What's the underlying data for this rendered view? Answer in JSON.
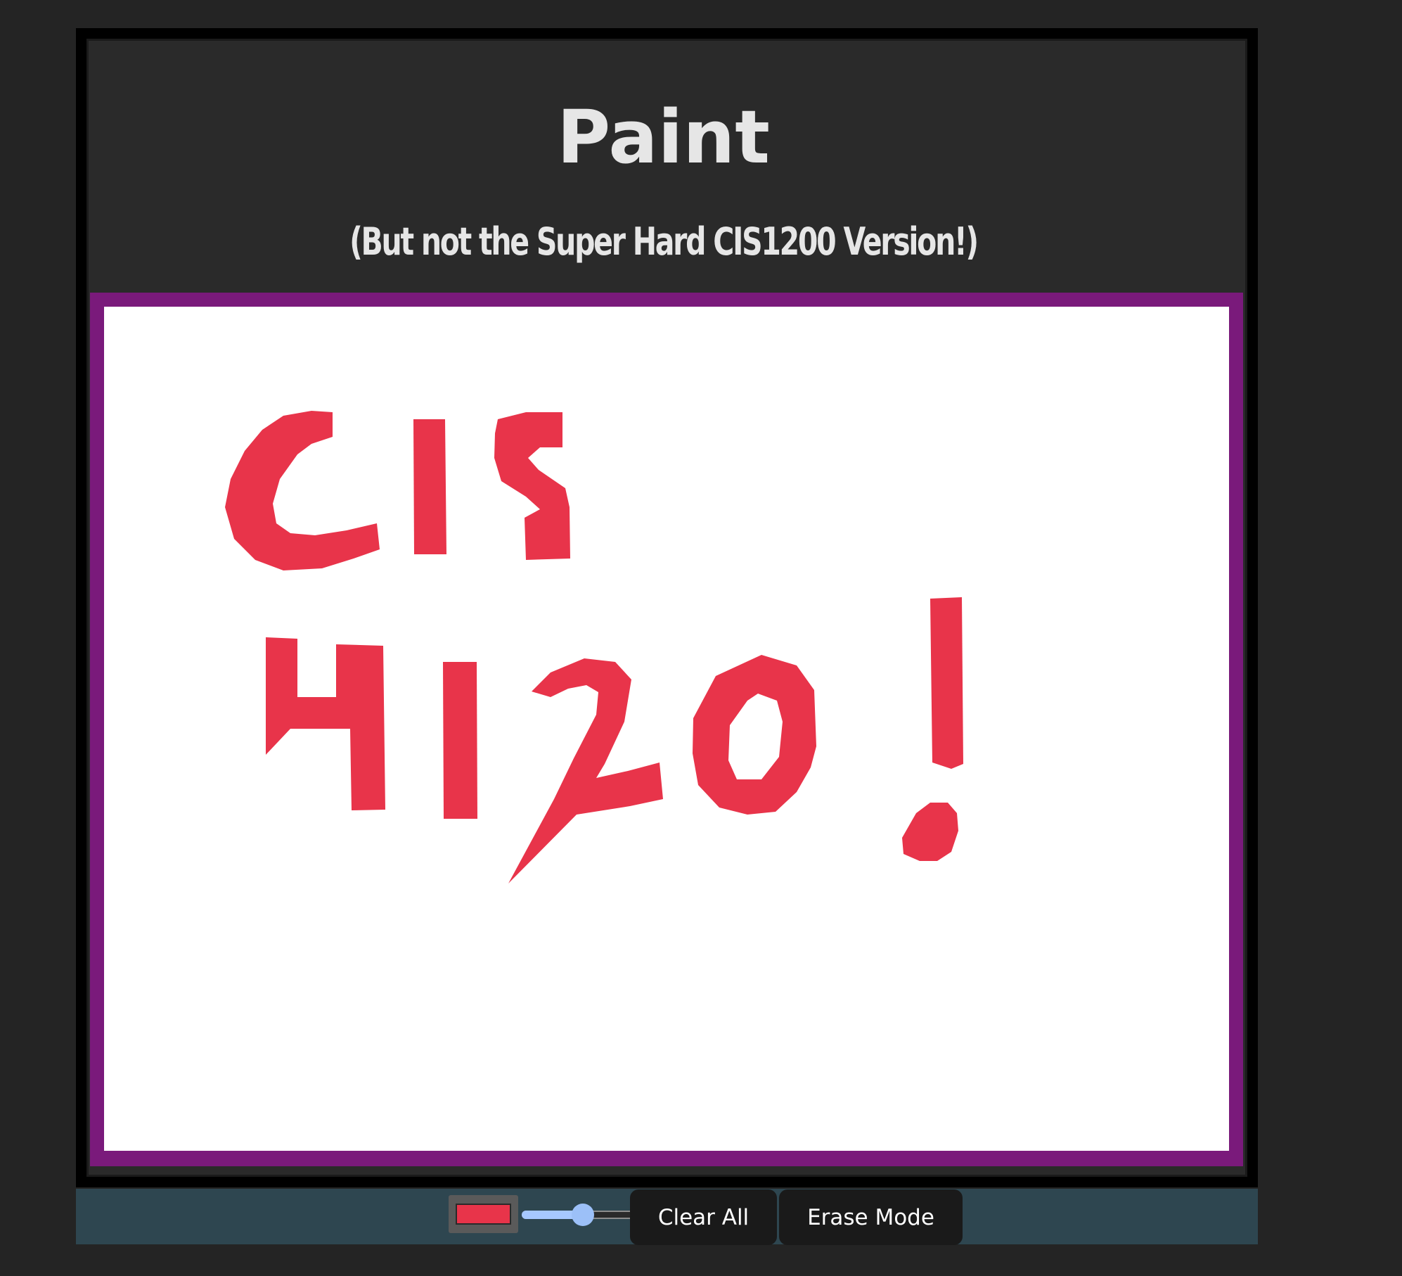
{
  "app": {
    "title": "Paint",
    "subtitle": "(But not the Super Hard CIS1200 Version!)"
  },
  "canvas": {
    "drawing_text": "CIS 4120 !",
    "stroke_color": "#e8344a",
    "background": "#ffffff",
    "border_color": "#7a1a7b"
  },
  "toolbar": {
    "color_value": "#e8344a",
    "brush_size_fraction": 0.34,
    "clear_label": "Clear All",
    "erase_label": "Erase Mode"
  },
  "colors": {
    "page_background": "#242424",
    "header_background": "#2a2a2a",
    "toolbar_background": "#2e4650",
    "button_background": "#1a1a1a",
    "slider_fill": "#a6c8ff"
  }
}
